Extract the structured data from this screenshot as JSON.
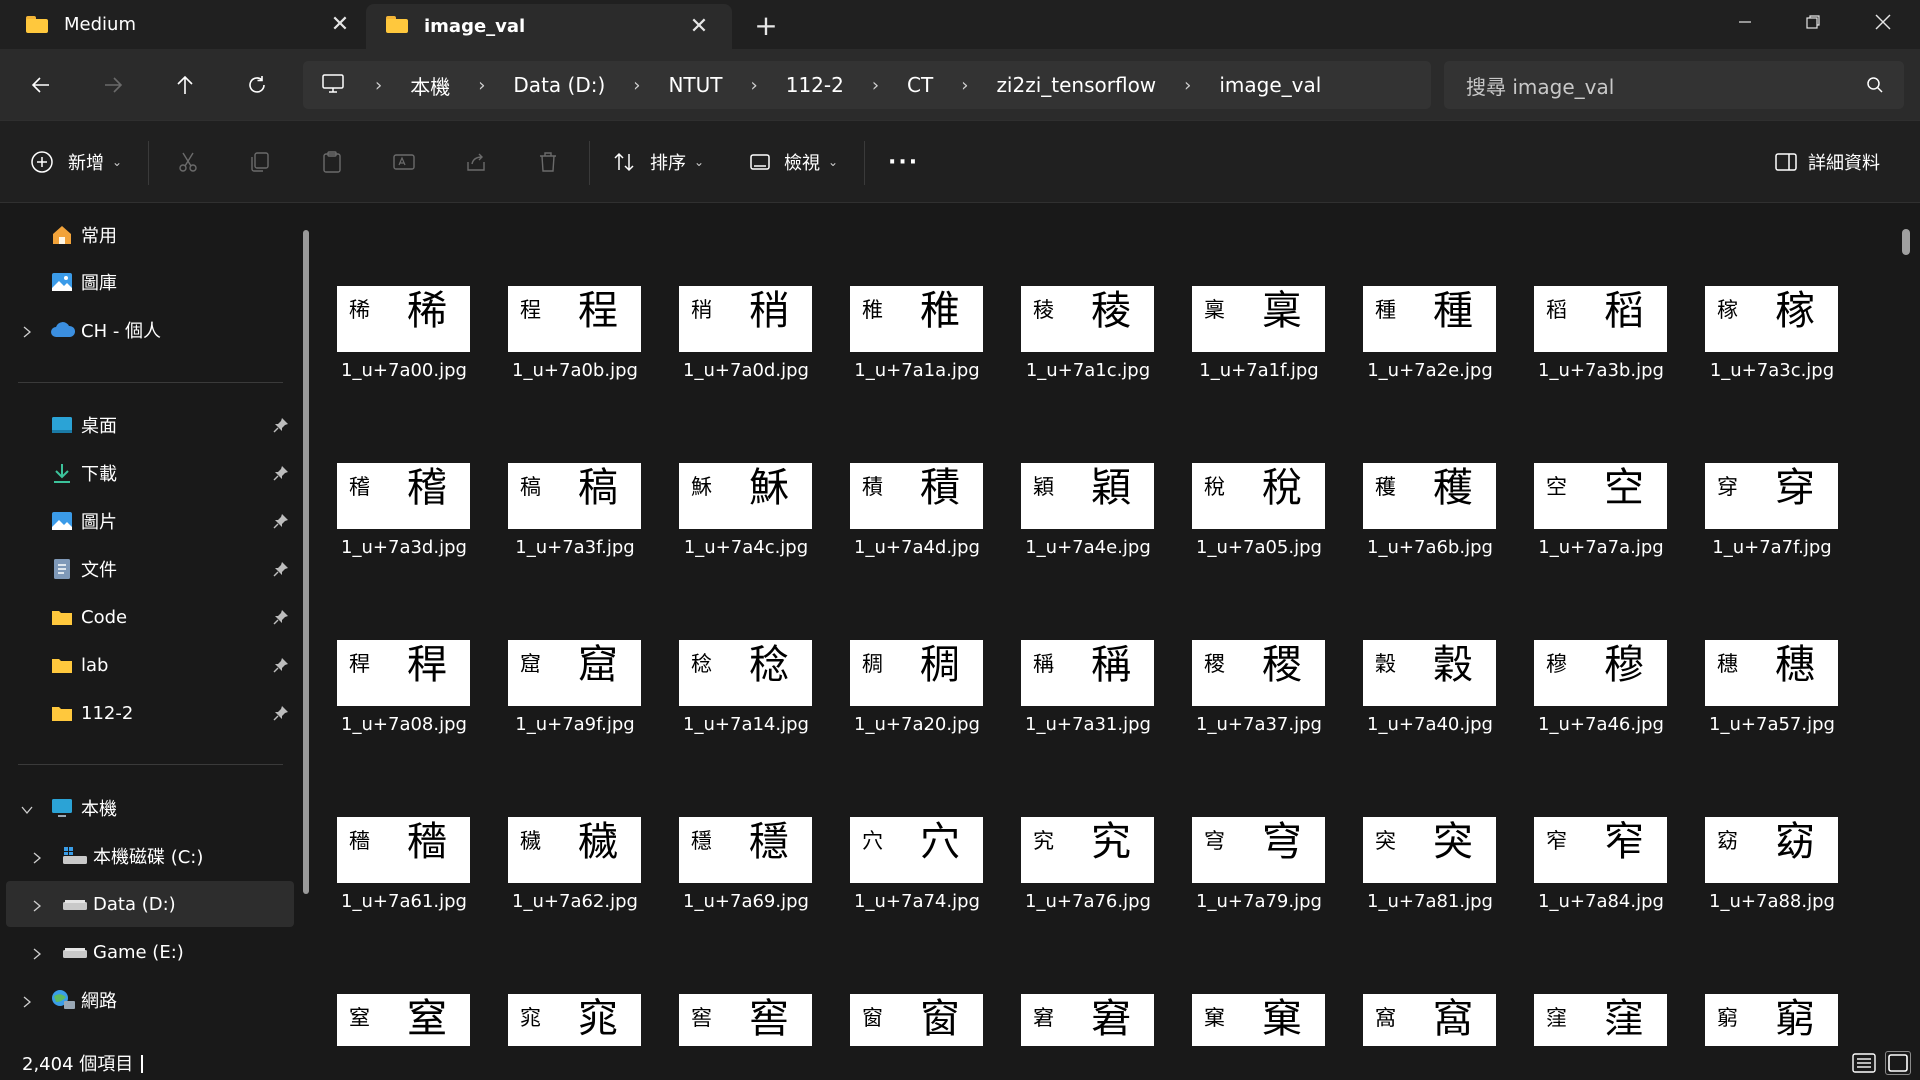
{
  "tabs": [
    {
      "title": "Medium",
      "active": false
    },
    {
      "title": "image_val",
      "active": true
    }
  ],
  "window": {
    "accent_folder": "#ffc83d"
  },
  "address": {
    "crumbs": [
      "本機",
      "Data (D:)",
      "NTUT",
      "112-2",
      "CT",
      "zi2zi_tensorflow",
      "image_val"
    ]
  },
  "search": {
    "placeholder": "搜尋 image_val"
  },
  "commands": {
    "new_label": "新增",
    "sort_label": "排序",
    "view_label": "檢視",
    "details_label": "詳細資料"
  },
  "sidebar": {
    "quick": [
      {
        "label": "常用",
        "icon": "home-icon"
      },
      {
        "label": "圖庫",
        "icon": "gallery-icon"
      },
      {
        "label": "CH - 個人",
        "icon": "cloud-icon",
        "expandable": true
      }
    ],
    "pinned": [
      {
        "label": "桌面",
        "icon": "desktop-icon"
      },
      {
        "label": "下載",
        "icon": "download-icon"
      },
      {
        "label": "圖片",
        "icon": "pictures-icon"
      },
      {
        "label": "文件",
        "icon": "documents-icon"
      },
      {
        "label": "Code",
        "icon": "folder-icon"
      },
      {
        "label": "lab",
        "icon": "folder-icon"
      },
      {
        "label": "112-2",
        "icon": "folder-icon"
      }
    ],
    "this_pc": {
      "label": "本機",
      "icon": "computer-icon"
    },
    "drives": [
      {
        "label": "本機磁碟 (C:)",
        "icon": "windows-drive-icon",
        "selected": false
      },
      {
        "label": "Data (D:)",
        "icon": "drive-icon",
        "selected": true
      },
      {
        "label": "Game (E:)",
        "icon": "drive-icon",
        "selected": false
      }
    ],
    "network": {
      "label": "網路",
      "icon": "network-icon"
    }
  },
  "files": [
    {
      "name": "1_u+7a00.jpg",
      "char": "稀"
    },
    {
      "name": "1_u+7a0b.jpg",
      "char": "程"
    },
    {
      "name": "1_u+7a0d.jpg",
      "char": "稍"
    },
    {
      "name": "1_u+7a1a.jpg",
      "char": "稚"
    },
    {
      "name": "1_u+7a1c.jpg",
      "char": "稜"
    },
    {
      "name": "1_u+7a1f.jpg",
      "char": "稟"
    },
    {
      "name": "1_u+7a2e.jpg",
      "char": "種"
    },
    {
      "name": "1_u+7a3b.jpg",
      "char": "稻"
    },
    {
      "name": "1_u+7a3c.jpg",
      "char": "稼"
    },
    {
      "name": "1_u+7a3d.jpg",
      "char": "稽"
    },
    {
      "name": "1_u+7a3f.jpg",
      "char": "稿"
    },
    {
      "name": "1_u+7a4c.jpg",
      "char": "穌"
    },
    {
      "name": "1_u+7a4d.jpg",
      "char": "積"
    },
    {
      "name": "1_u+7a4e.jpg",
      "char": "穎"
    },
    {
      "name": "1_u+7a05.jpg",
      "char": "稅"
    },
    {
      "name": "1_u+7a6b.jpg",
      "char": "穫"
    },
    {
      "name": "1_u+7a7a.jpg",
      "char": "空"
    },
    {
      "name": "1_u+7a7f.jpg",
      "char": "穿"
    },
    {
      "name": "1_u+7a08.jpg",
      "char": "稈"
    },
    {
      "name": "1_u+7a9f.jpg",
      "char": "窟"
    },
    {
      "name": "1_u+7a14.jpg",
      "char": "稔"
    },
    {
      "name": "1_u+7a20.jpg",
      "char": "稠"
    },
    {
      "name": "1_u+7a31.jpg",
      "char": "稱"
    },
    {
      "name": "1_u+7a37.jpg",
      "char": "稷"
    },
    {
      "name": "1_u+7a40.jpg",
      "char": "穀"
    },
    {
      "name": "1_u+7a46.jpg",
      "char": "穆"
    },
    {
      "name": "1_u+7a57.jpg",
      "char": "穗"
    },
    {
      "name": "1_u+7a61.jpg",
      "char": "穡"
    },
    {
      "name": "1_u+7a62.jpg",
      "char": "穢"
    },
    {
      "name": "1_u+7a69.jpg",
      "char": "穩"
    },
    {
      "name": "1_u+7a74.jpg",
      "char": "穴"
    },
    {
      "name": "1_u+7a76.jpg",
      "char": "究"
    },
    {
      "name": "1_u+7a79.jpg",
      "char": "穹"
    },
    {
      "name": "1_u+7a81.jpg",
      "char": "突"
    },
    {
      "name": "1_u+7a84.jpg",
      "char": "窄"
    },
    {
      "name": "1_u+7a88.jpg",
      "char": "窈"
    },
    {
      "name": "",
      "char": "窒"
    },
    {
      "name": "",
      "char": "窕"
    },
    {
      "name": "",
      "char": "窖"
    },
    {
      "name": "",
      "char": "窗"
    },
    {
      "name": "",
      "char": "窘"
    },
    {
      "name": "",
      "char": "窠"
    },
    {
      "name": "",
      "char": "窩"
    },
    {
      "name": "",
      "char": "窪"
    },
    {
      "name": "",
      "char": "窮"
    }
  ],
  "status": {
    "item_count": "2,404 個項目"
  }
}
